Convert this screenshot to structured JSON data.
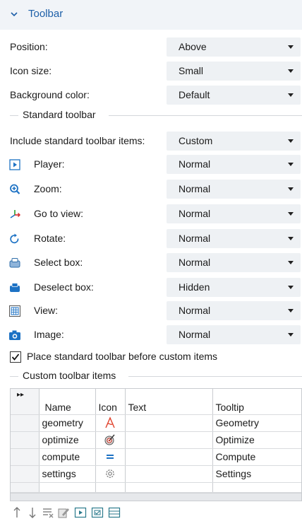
{
  "section": {
    "title": "Toolbar",
    "icon": "chevron-down-icon"
  },
  "rows": [
    {
      "label": "Position:",
      "value": "Above"
    },
    {
      "label": "Icon size:",
      "value": "Small"
    },
    {
      "label": "Background color:",
      "value": "Default"
    }
  ],
  "standard_group": {
    "title": "Standard toolbar"
  },
  "include_row": {
    "label": "Include standard toolbar items:",
    "value": "Custom"
  },
  "tool_rows": [
    {
      "label": "Player:",
      "value": "Normal",
      "icon": "player-icon"
    },
    {
      "label": "Zoom:",
      "value": "Normal",
      "icon": "zoom-icon"
    },
    {
      "label": "Go to view:",
      "value": "Normal",
      "icon": "go-to-view-icon"
    },
    {
      "label": "Rotate:",
      "value": "Normal",
      "icon": "rotate-icon"
    },
    {
      "label": "Select box:",
      "value": "Normal",
      "icon": "select-box-icon"
    },
    {
      "label": "Deselect box:",
      "value": "Hidden",
      "icon": "deselect-box-icon"
    },
    {
      "label": "View:",
      "value": "Normal",
      "icon": "view-icon"
    },
    {
      "label": "Image:",
      "value": "Normal",
      "icon": "camera-icon"
    }
  ],
  "place_before": {
    "label": "Place standard toolbar before custom items",
    "checked": true
  },
  "custom_group": {
    "title": "Custom toolbar items"
  },
  "table": {
    "corner": "▸▸",
    "headers": [
      "Name",
      "Icon",
      "Text",
      "Tooltip"
    ],
    "rows": [
      {
        "name": "geometry",
        "icon": "geometry-icon",
        "text": "",
        "tooltip": "Geometry"
      },
      {
        "name": "optimize",
        "icon": "optimize-icon",
        "text": "",
        "tooltip": "Optimize"
      },
      {
        "name": "compute",
        "icon": "compute-icon",
        "text": "",
        "tooltip": "Compute"
      },
      {
        "name": "settings",
        "icon": "settings-icon",
        "text": "",
        "tooltip": "Settings"
      }
    ]
  },
  "bottom_toolbar": [
    "move-up-icon",
    "move-down-icon",
    "clear-table-icon",
    "edit-icon",
    "player-icon",
    "checkbox-icon",
    "table-icon"
  ],
  "colors": {
    "accent": "#1d5fa8",
    "header_bg": "#f1f4f8",
    "select_bg": "#eef1f4"
  }
}
